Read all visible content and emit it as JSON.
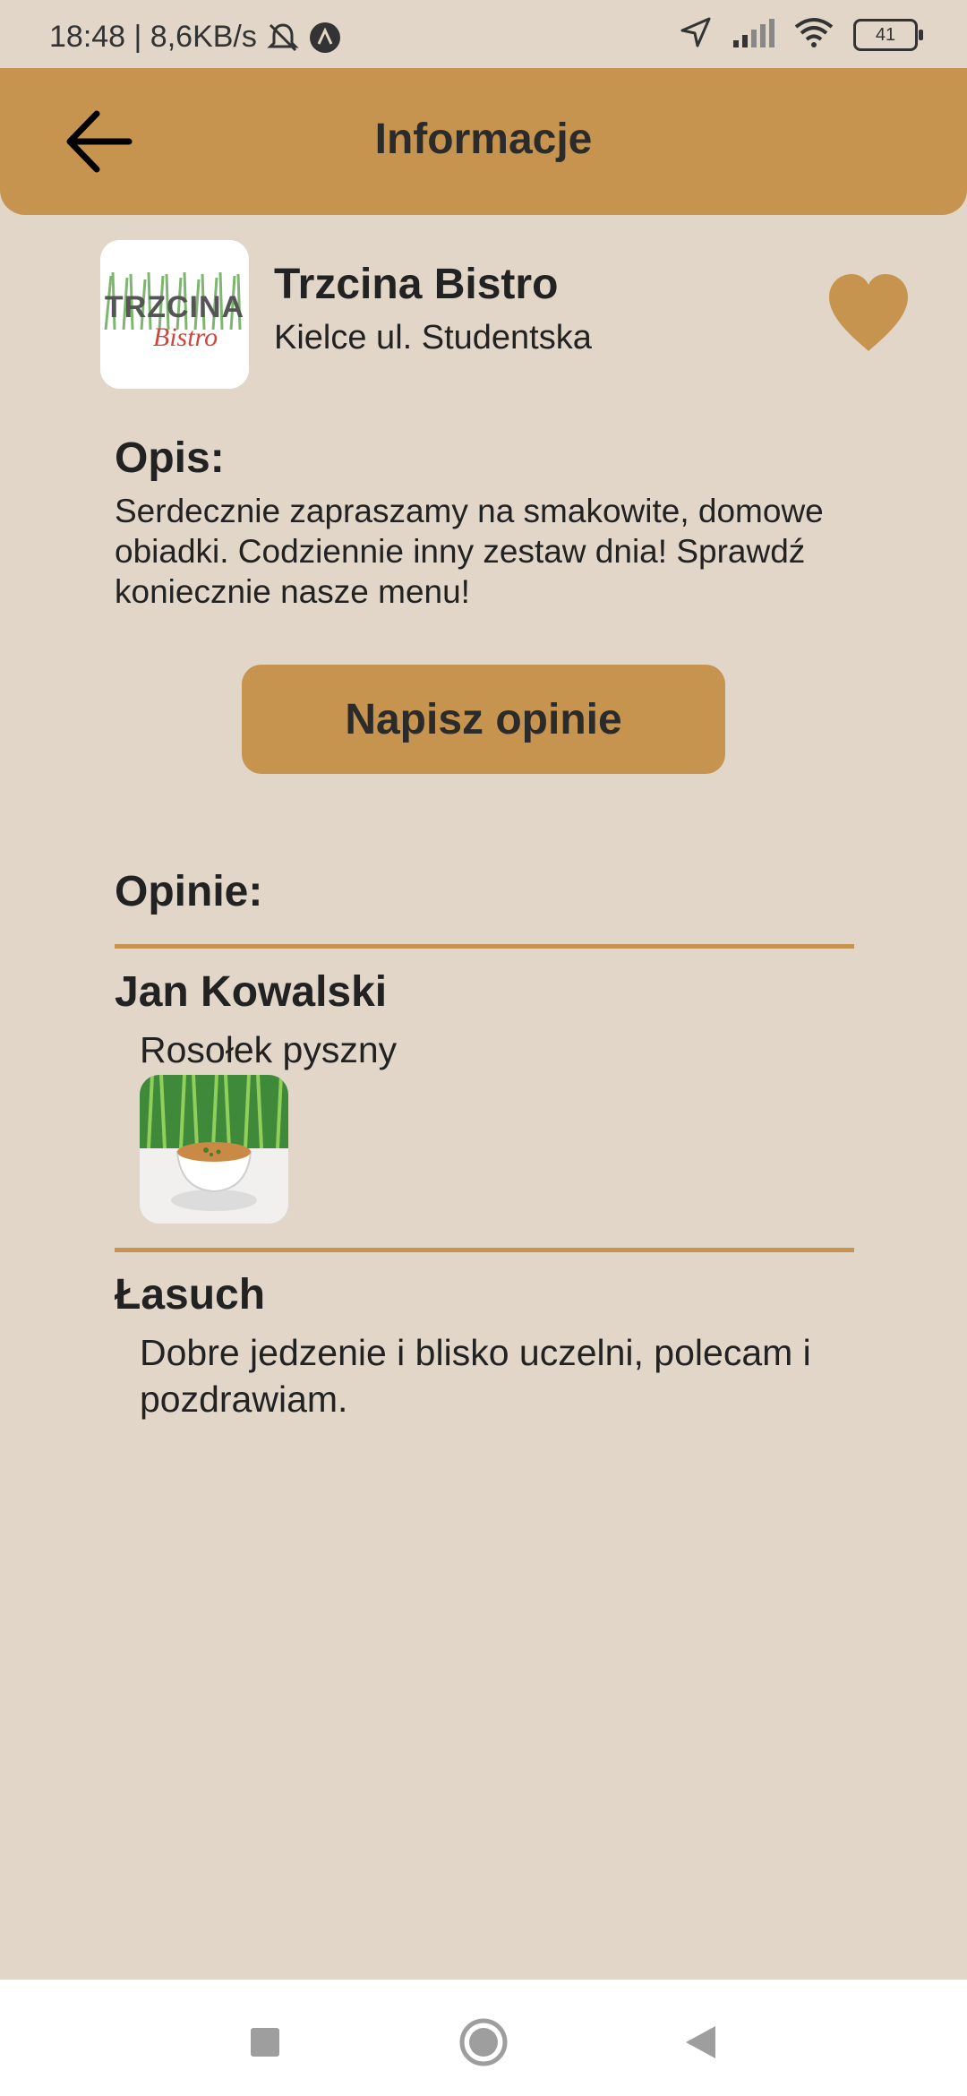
{
  "status_bar": {
    "time_speed": "18:48 | 8,6KB/s",
    "battery": "41"
  },
  "header": {
    "title": "Informacje"
  },
  "restaurant": {
    "name": "Trzcina Bistro",
    "address": "Kielce ul. Studentska",
    "logo_text_main": "TRZCINA",
    "logo_text_script": "Bistro"
  },
  "description": {
    "heading": "Opis:",
    "text": "Serdecznie zapraszamy na smakowite, domowe obiadki. Codziennie inny zestaw dnia! Sprawdź koniecznie nasze menu!"
  },
  "review_button": {
    "label": "Napisz opinie"
  },
  "reviews": {
    "heading": "Opinie:",
    "items": [
      {
        "author": "Jan Kowalski",
        "text": "Rosołek pyszny"
      },
      {
        "author": "Łasuch",
        "text": "Dobre jedzenie i blisko uczelni, polecam i pozdrawiam."
      }
    ]
  },
  "colors": {
    "accent": "#c6944e",
    "background": "#e2d6c8",
    "text": "#222222"
  },
  "icons": {
    "back": "arrow-left-icon",
    "favorite": "heart-icon",
    "nav_recents": "square-icon",
    "nav_home": "circle-icon",
    "nav_back": "triangle-back-icon"
  }
}
